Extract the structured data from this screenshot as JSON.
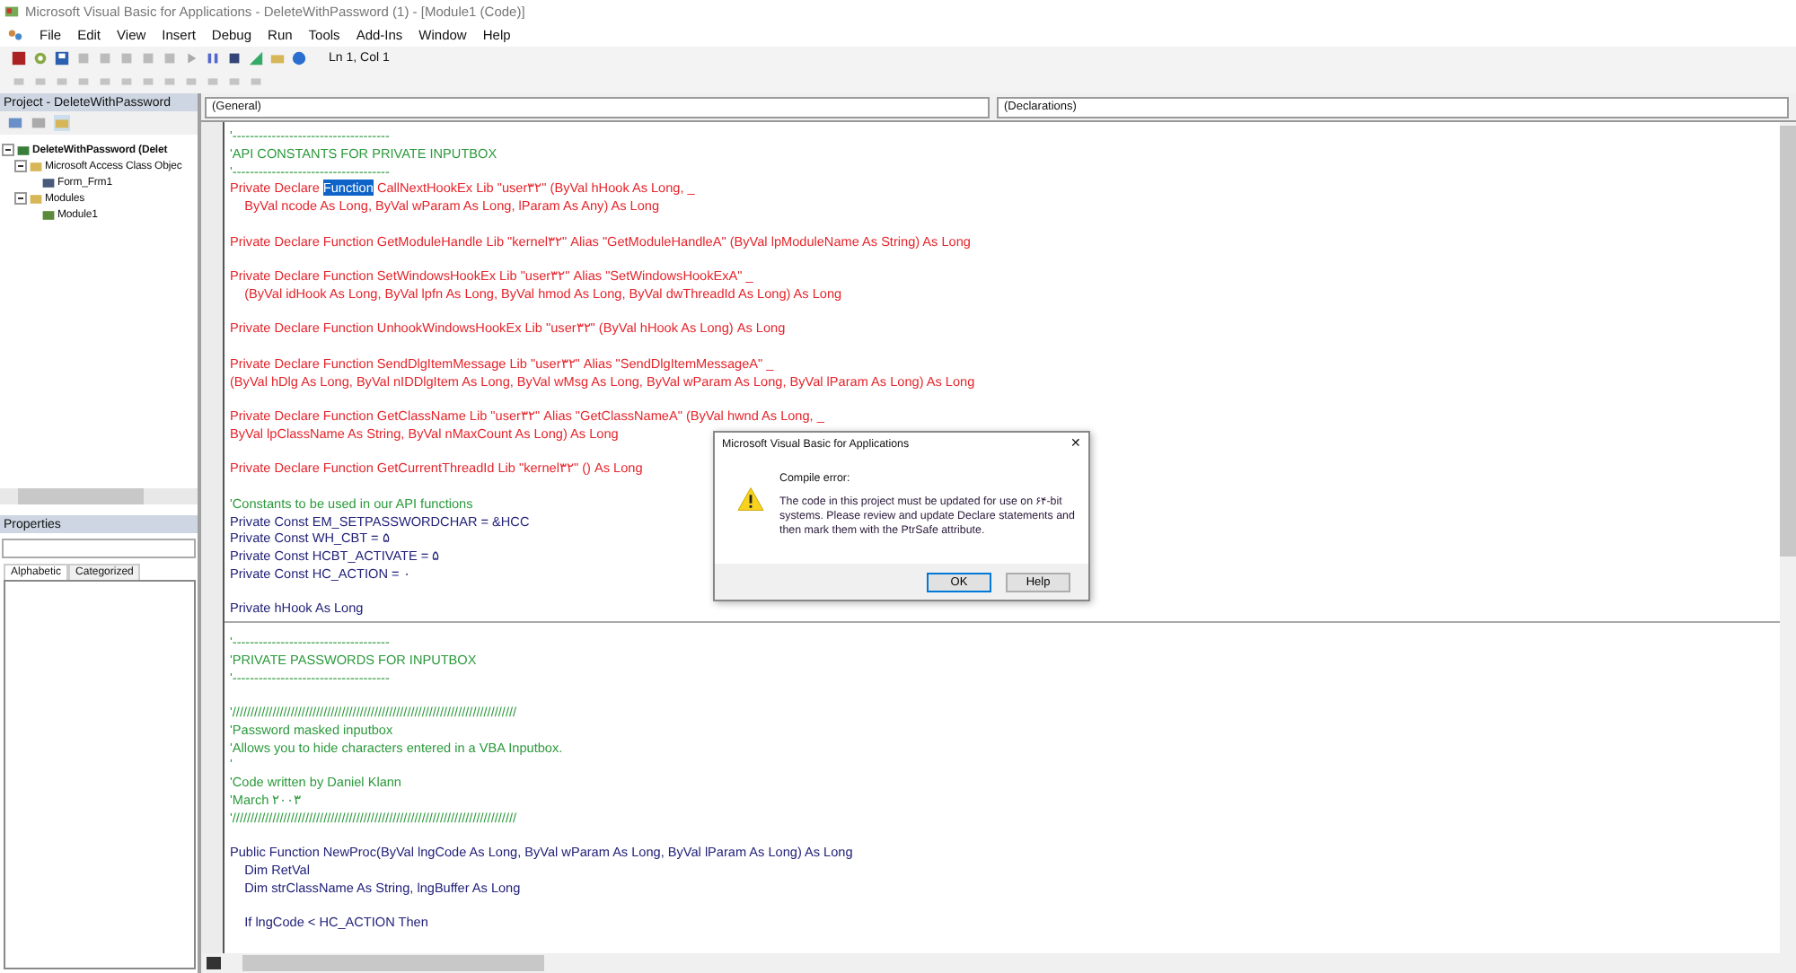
{
  "window": {
    "title": "Microsoft Visual Basic for Applications - DeleteWithPassword (1) - [Module1 (Code)]"
  },
  "menu": [
    "File",
    "Edit",
    "View",
    "Insert",
    "Debug",
    "Run",
    "Tools",
    "Add-Ins",
    "Window",
    "Help"
  ],
  "toolbar": {
    "position": "Ln 1, Col 1"
  },
  "project": {
    "title": "Project - DeleteWithPassword",
    "tree": [
      {
        "label": "DeleteWithPassword (Delet",
        "kind": "project",
        "expanded": true,
        "children": [
          {
            "label": "Microsoft Access Class Objec",
            "kind": "folder",
            "expanded": true,
            "children": [
              {
                "label": "Form_Frm1",
                "kind": "form"
              }
            ]
          },
          {
            "label": "Modules",
            "kind": "folder",
            "expanded": true,
            "children": [
              {
                "label": "Module1",
                "kind": "module"
              }
            ]
          }
        ]
      }
    ]
  },
  "properties": {
    "title": "Properties",
    "tabs": [
      {
        "label": "Alphabetic",
        "selected": true
      },
      {
        "label": "Categorized",
        "selected": false
      }
    ]
  },
  "code": {
    "object": "(General)",
    "procedure": "(Declarations)",
    "lines": [
      {
        "kind": "comment",
        "text": "'------------------------------------"
      },
      {
        "kind": "comment",
        "text": "'API CONSTANTS FOR PRIVATE INPUTBOX"
      },
      {
        "kind": "comment",
        "text": "'------------------------------------"
      },
      {
        "kind": "error",
        "text": "Private Declare ",
        "selection": "Function",
        "rest": " CallNextHookEx Lib \"user۳۲\" (ByVal hHook As Long, _"
      },
      {
        "kind": "error",
        "text": "    ByVal ncode As Long, ByVal wParam As Long, lParam As Any) As Long"
      },
      {
        "kind": "blank"
      },
      {
        "kind": "error",
        "text": "Private Declare Function GetModuleHandle Lib \"kernel۳۲\" Alias \"GetModuleHandleA\" (ByVal lpModuleName As String) As Long"
      },
      {
        "kind": "blank"
      },
      {
        "kind": "error",
        "text": "Private Declare Function SetWindowsHookEx Lib \"user۳۲\" Alias \"SetWindowsHookExA\" _"
      },
      {
        "kind": "error",
        "text": "    (ByVal idHook As Long, ByVal lpfn As Long, ByVal hmod As Long, ByVal dwThreadId As Long) As Long"
      },
      {
        "kind": "blank"
      },
      {
        "kind": "error",
        "text": "Private Declare Function UnhookWindowsHookEx Lib \"user۳۲\" (ByVal hHook As Long) As Long"
      },
      {
        "kind": "blank"
      },
      {
        "kind": "error",
        "text": "Private Declare Function SendDlgItemMessage Lib \"user۳۲\" Alias \"SendDlgItemMessageA\" _"
      },
      {
        "kind": "error",
        "text": "(ByVal hDlg As Long, ByVal nIDDlgItem As Long, ByVal wMsg As Long, ByVal wParam As Long, ByVal lParam As Long) As Long"
      },
      {
        "kind": "blank"
      },
      {
        "kind": "error",
        "text": "Private Declare Function GetClassName Lib \"user۳۲\" Alias \"GetClassNameA\" (ByVal hwnd As Long, _"
      },
      {
        "kind": "error",
        "text": "ByVal lpClassName As String, ByVal nMaxCount As Long) As Long"
      },
      {
        "kind": "blank"
      },
      {
        "kind": "error",
        "text": "Private Declare Function GetCurrentThreadId Lib \"kernel۳۲\" () As Long"
      },
      {
        "kind": "blank"
      },
      {
        "kind": "comment",
        "text": "'Constants to be used in our API functions"
      },
      {
        "kind": "code",
        "text": "Private Const EM_SETPASSWORDCHAR = &HCC"
      },
      {
        "kind": "code",
        "text": "Private Const WH_CBT = ۵"
      },
      {
        "kind": "code",
        "text": "Private Const HCBT_ACTIVATE = ۵"
      },
      {
        "kind": "code",
        "text": "Private Const HC_ACTION = ۰"
      },
      {
        "kind": "blank"
      },
      {
        "kind": "code",
        "text": "Private hHook As Long"
      },
      {
        "kind": "divider"
      },
      {
        "kind": "comment",
        "text": "'------------------------------------"
      },
      {
        "kind": "comment",
        "text": "'PRIVATE PASSWORDS FOR INPUTBOX"
      },
      {
        "kind": "comment",
        "text": "'------------------------------------"
      },
      {
        "kind": "blank"
      },
      {
        "kind": "comment",
        "text": "'//////////////////////////////////////////////////////////////////////////////"
      },
      {
        "kind": "comment",
        "text": "'Password masked inputbox"
      },
      {
        "kind": "comment",
        "text": "'Allows you to hide characters entered in a VBA Inputbox."
      },
      {
        "kind": "comment",
        "text": "'"
      },
      {
        "kind": "comment",
        "text": "'Code written by Daniel Klann"
      },
      {
        "kind": "comment",
        "text": "'March ۲۰۰۳"
      },
      {
        "kind": "comment",
        "text": "'//////////////////////////////////////////////////////////////////////////////"
      },
      {
        "kind": "blank"
      },
      {
        "kind": "code",
        "text": "Public Function NewProc(ByVal lngCode As Long, ByVal wParam As Long, ByVal lParam As Long) As Long"
      },
      {
        "kind": "code",
        "text": "    Dim RetVal"
      },
      {
        "kind": "code",
        "text": "    Dim strClassName As String, lngBuffer As Long"
      },
      {
        "kind": "blank"
      },
      {
        "kind": "code",
        "text": "    If lngCode < HC_ACTION Then"
      }
    ]
  },
  "dialog": {
    "title": "Microsoft Visual Basic for Applications",
    "close": "✕",
    "heading": "Compile error:",
    "message": "The code in this project must be updated for use on ۶۴-bit systems.  Please review and update Declare statements and then mark them with the PtrSafe attribute.",
    "buttons": [
      "OK",
      "Help"
    ]
  }
}
